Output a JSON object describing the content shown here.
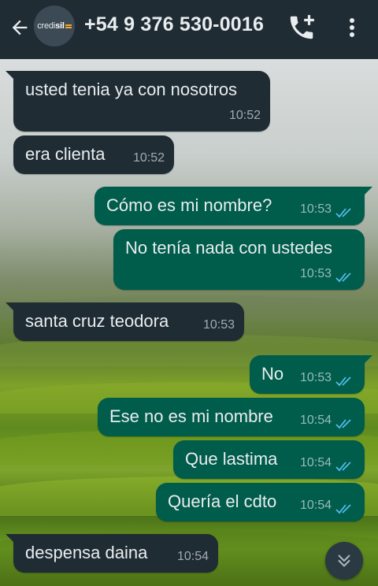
{
  "header": {
    "contact_name": "+54 9 376 530-0016",
    "avatar_brand_prefix": "credi",
    "avatar_brand_suffix": "sil",
    "back_icon": "arrow-left-icon",
    "call_icon": "add-call-icon",
    "menu_icon": "more-vert-icon"
  },
  "colors": {
    "header_bg": "#1f2c34",
    "incoming_bubble": "#1f2c34",
    "outgoing_bubble": "#005c4b",
    "read_ticks": "#53bdeb"
  },
  "messages": [
    {
      "direction": "in",
      "text": "usted tenia ya con nosotros",
      "time": "10:52"
    },
    {
      "direction": "in",
      "text": "era clienta",
      "time": "10:52"
    },
    {
      "direction": "out",
      "text": "Cómo es mi nombre?",
      "time": "10:53",
      "status": "read"
    },
    {
      "direction": "out",
      "text": "No tenía nada con ustedes",
      "time": "10:53",
      "status": "read"
    },
    {
      "direction": "in",
      "text": "santa cruz teodora",
      "time": "10:53"
    },
    {
      "direction": "out",
      "text": "No",
      "time": "10:53",
      "status": "read"
    },
    {
      "direction": "out",
      "text": "Ese no es mi nombre",
      "time": "10:54",
      "status": "read"
    },
    {
      "direction": "out",
      "text": "Que lastima",
      "time": "10:54",
      "status": "read"
    },
    {
      "direction": "out",
      "text": "Quería el cdto",
      "time": "10:54",
      "status": "read"
    },
    {
      "direction": "in",
      "text": "despensa daina",
      "time": "10:54"
    }
  ],
  "scroll_button_icon": "chevron-double-down-icon"
}
